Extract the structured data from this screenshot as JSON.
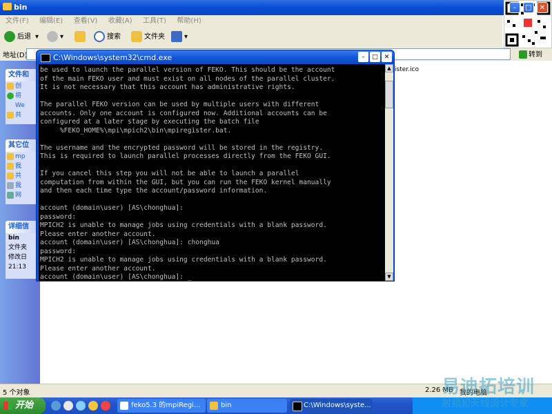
{
  "explorer": {
    "title": "bin",
    "menu": [
      "文件(F)",
      "编辑(E)",
      "查看(V)",
      "收藏(A)",
      "工具(T)",
      "帮助(H)"
    ],
    "toolbar": {
      "back": "后退",
      "search": "搜索",
      "folders": "文件夹"
    },
    "address_label": "地址(D)",
    "go": "转到",
    "task_pane": {
      "sections": [
        {
          "title": "文件和",
          "items": [
            "创",
            "将",
            "We",
            "共"
          ]
        },
        {
          "title": "其它位",
          "items": [
            "mp",
            "我",
            "共",
            "我",
            "网"
          ]
        },
        {
          "title": "详细信",
          "items": [
            "bin",
            "文件夹",
            "修改日",
            "21:13"
          ]
        }
      ]
    },
    "file_fragment": "ister.ico",
    "status": {
      "objects": "5 个对象",
      "size": "2.26 MB",
      "location": "我的电脑"
    }
  },
  "cmd": {
    "title": "C:\\Windows\\system32\\cmd.exe",
    "lines": [
      "be used to launch the parallel version of FEKO. This should be the account",
      "of the main FEKO user and must exist on all nodes of the parallel cluster.",
      "It is not necessary that this account has administrative rights.",
      "",
      "The parallel FEKO version can be used by multiple users with different",
      "accounts. Only one account is configured now. Additional accounts can be",
      "configured at a later stage by executing the batch file",
      "     %FEKO_HOME%\\mpi\\mpich2\\bin\\mpiregister.bat.",
      "",
      "The username and the encrypted password will be stored in the registry.",
      "This is required to launch parallel processes directly from the FEKO GUI.",
      "",
      "If you cancel this step you will not be able to launch a parallel",
      "computation from within the GUI, but you can run the FEKO kernel manually",
      "and then each time type the account/password information.",
      "",
      "account (domain\\user) [AS\\chonghua]:",
      "password:",
      "MPICH2 is unable to manage jobs using credentials with a blank password.",
      "Please enter another account.",
      "account (domain\\user) [AS\\chonghua]: chonghua",
      "password:",
      "MPICH2 is unable to manage jobs using credentials with a blank password.",
      "Please enter another account.",
      "account (domain\\user) [AS\\chonghua]: _"
    ]
  },
  "taskbar": {
    "start": "开始",
    "tasks": [
      {
        "label": "feko5.3 的mpiRegi..."
      },
      {
        "label": "bin"
      },
      {
        "label": "C:\\Windows\\syste..."
      }
    ]
  },
  "watermark": {
    "line1": "易迪拓培训",
    "line2": "射频和天线设计专家"
  },
  "colors": {
    "xp_blue": "#0a4fd8",
    "console_bg": "#000000",
    "console_fg": "#c0c0c0",
    "start_green": "#2d8a2d"
  }
}
